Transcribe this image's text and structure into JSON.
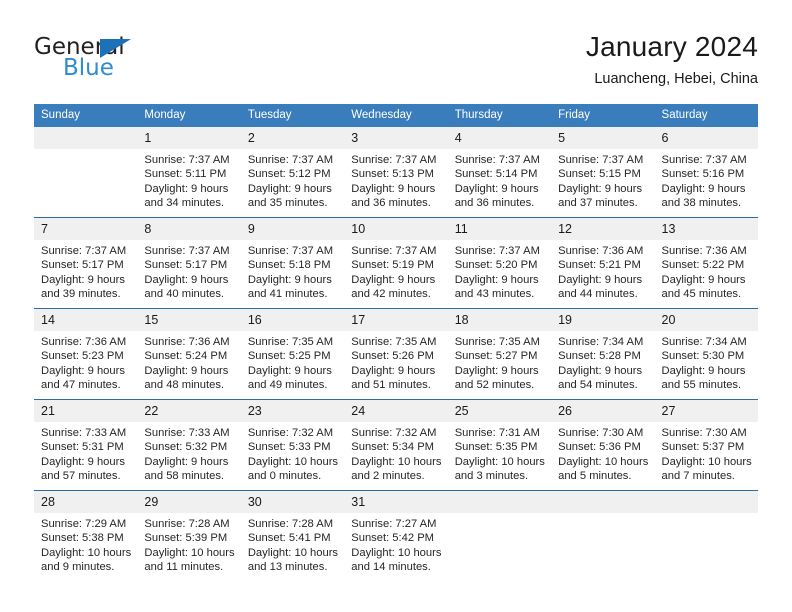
{
  "brand": {
    "name_part1": "General",
    "name_part2": "Blue",
    "triangle_icon": "triangle-icon",
    "accent_dark": "#1d71b8",
    "accent_light": "#2e8bd4"
  },
  "header": {
    "title": "January 2024",
    "subtitle": "Luancheng, Hebei, China"
  },
  "theme": {
    "header_blue": "#3a7dbd",
    "row_divider_blue": "#2e6da4",
    "daynum_band": "#f0f0f0"
  },
  "weekdays": [
    "Sunday",
    "Monday",
    "Tuesday",
    "Wednesday",
    "Thursday",
    "Friday",
    "Saturday"
  ],
  "labels": {
    "sunrise_prefix": "Sunrise:",
    "sunset_prefix": "Sunset:",
    "daylight_prefix": "Daylight:"
  },
  "weeks": [
    [
      {
        "day": "",
        "sunrise": "",
        "sunset": "",
        "daylight_line1": "",
        "daylight_line2": ""
      },
      {
        "day": "1",
        "sunrise": "Sunrise: 7:37 AM",
        "sunset": "Sunset: 5:11 PM",
        "daylight_line1": "Daylight: 9 hours",
        "daylight_line2": "and 34 minutes."
      },
      {
        "day": "2",
        "sunrise": "Sunrise: 7:37 AM",
        "sunset": "Sunset: 5:12 PM",
        "daylight_line1": "Daylight: 9 hours",
        "daylight_line2": "and 35 minutes."
      },
      {
        "day": "3",
        "sunrise": "Sunrise: 7:37 AM",
        "sunset": "Sunset: 5:13 PM",
        "daylight_line1": "Daylight: 9 hours",
        "daylight_line2": "and 36 minutes."
      },
      {
        "day": "4",
        "sunrise": "Sunrise: 7:37 AM",
        "sunset": "Sunset: 5:14 PM",
        "daylight_line1": "Daylight: 9 hours",
        "daylight_line2": "and 36 minutes."
      },
      {
        "day": "5",
        "sunrise": "Sunrise: 7:37 AM",
        "sunset": "Sunset: 5:15 PM",
        "daylight_line1": "Daylight: 9 hours",
        "daylight_line2": "and 37 minutes."
      },
      {
        "day": "6",
        "sunrise": "Sunrise: 7:37 AM",
        "sunset": "Sunset: 5:16 PM",
        "daylight_line1": "Daylight: 9 hours",
        "daylight_line2": "and 38 minutes."
      }
    ],
    [
      {
        "day": "7",
        "sunrise": "Sunrise: 7:37 AM",
        "sunset": "Sunset: 5:17 PM",
        "daylight_line1": "Daylight: 9 hours",
        "daylight_line2": "and 39 minutes."
      },
      {
        "day": "8",
        "sunrise": "Sunrise: 7:37 AM",
        "sunset": "Sunset: 5:17 PM",
        "daylight_line1": "Daylight: 9 hours",
        "daylight_line2": "and 40 minutes."
      },
      {
        "day": "9",
        "sunrise": "Sunrise: 7:37 AM",
        "sunset": "Sunset: 5:18 PM",
        "daylight_line1": "Daylight: 9 hours",
        "daylight_line2": "and 41 minutes."
      },
      {
        "day": "10",
        "sunrise": "Sunrise: 7:37 AM",
        "sunset": "Sunset: 5:19 PM",
        "daylight_line1": "Daylight: 9 hours",
        "daylight_line2": "and 42 minutes."
      },
      {
        "day": "11",
        "sunrise": "Sunrise: 7:37 AM",
        "sunset": "Sunset: 5:20 PM",
        "daylight_line1": "Daylight: 9 hours",
        "daylight_line2": "and 43 minutes."
      },
      {
        "day": "12",
        "sunrise": "Sunrise: 7:36 AM",
        "sunset": "Sunset: 5:21 PM",
        "daylight_line1": "Daylight: 9 hours",
        "daylight_line2": "and 44 minutes."
      },
      {
        "day": "13",
        "sunrise": "Sunrise: 7:36 AM",
        "sunset": "Sunset: 5:22 PM",
        "daylight_line1": "Daylight: 9 hours",
        "daylight_line2": "and 45 minutes."
      }
    ],
    [
      {
        "day": "14",
        "sunrise": "Sunrise: 7:36 AM",
        "sunset": "Sunset: 5:23 PM",
        "daylight_line1": "Daylight: 9 hours",
        "daylight_line2": "and 47 minutes."
      },
      {
        "day": "15",
        "sunrise": "Sunrise: 7:36 AM",
        "sunset": "Sunset: 5:24 PM",
        "daylight_line1": "Daylight: 9 hours",
        "daylight_line2": "and 48 minutes."
      },
      {
        "day": "16",
        "sunrise": "Sunrise: 7:35 AM",
        "sunset": "Sunset: 5:25 PM",
        "daylight_line1": "Daylight: 9 hours",
        "daylight_line2": "and 49 minutes."
      },
      {
        "day": "17",
        "sunrise": "Sunrise: 7:35 AM",
        "sunset": "Sunset: 5:26 PM",
        "daylight_line1": "Daylight: 9 hours",
        "daylight_line2": "and 51 minutes."
      },
      {
        "day": "18",
        "sunrise": "Sunrise: 7:35 AM",
        "sunset": "Sunset: 5:27 PM",
        "daylight_line1": "Daylight: 9 hours",
        "daylight_line2": "and 52 minutes."
      },
      {
        "day": "19",
        "sunrise": "Sunrise: 7:34 AM",
        "sunset": "Sunset: 5:28 PM",
        "daylight_line1": "Daylight: 9 hours",
        "daylight_line2": "and 54 minutes."
      },
      {
        "day": "20",
        "sunrise": "Sunrise: 7:34 AM",
        "sunset": "Sunset: 5:30 PM",
        "daylight_line1": "Daylight: 9 hours",
        "daylight_line2": "and 55 minutes."
      }
    ],
    [
      {
        "day": "21",
        "sunrise": "Sunrise: 7:33 AM",
        "sunset": "Sunset: 5:31 PM",
        "daylight_line1": "Daylight: 9 hours",
        "daylight_line2": "and 57 minutes."
      },
      {
        "day": "22",
        "sunrise": "Sunrise: 7:33 AM",
        "sunset": "Sunset: 5:32 PM",
        "daylight_line1": "Daylight: 9 hours",
        "daylight_line2": "and 58 minutes."
      },
      {
        "day": "23",
        "sunrise": "Sunrise: 7:32 AM",
        "sunset": "Sunset: 5:33 PM",
        "daylight_line1": "Daylight: 10 hours",
        "daylight_line2": "and 0 minutes."
      },
      {
        "day": "24",
        "sunrise": "Sunrise: 7:32 AM",
        "sunset": "Sunset: 5:34 PM",
        "daylight_line1": "Daylight: 10 hours",
        "daylight_line2": "and 2 minutes."
      },
      {
        "day": "25",
        "sunrise": "Sunrise: 7:31 AM",
        "sunset": "Sunset: 5:35 PM",
        "daylight_line1": "Daylight: 10 hours",
        "daylight_line2": "and 3 minutes."
      },
      {
        "day": "26",
        "sunrise": "Sunrise: 7:30 AM",
        "sunset": "Sunset: 5:36 PM",
        "daylight_line1": "Daylight: 10 hours",
        "daylight_line2": "and 5 minutes."
      },
      {
        "day": "27",
        "sunrise": "Sunrise: 7:30 AM",
        "sunset": "Sunset: 5:37 PM",
        "daylight_line1": "Daylight: 10 hours",
        "daylight_line2": "and 7 minutes."
      }
    ],
    [
      {
        "day": "28",
        "sunrise": "Sunrise: 7:29 AM",
        "sunset": "Sunset: 5:38 PM",
        "daylight_line1": "Daylight: 10 hours",
        "daylight_line2": "and 9 minutes."
      },
      {
        "day": "29",
        "sunrise": "Sunrise: 7:28 AM",
        "sunset": "Sunset: 5:39 PM",
        "daylight_line1": "Daylight: 10 hours",
        "daylight_line2": "and 11 minutes."
      },
      {
        "day": "30",
        "sunrise": "Sunrise: 7:28 AM",
        "sunset": "Sunset: 5:41 PM",
        "daylight_line1": "Daylight: 10 hours",
        "daylight_line2": "and 13 minutes."
      },
      {
        "day": "31",
        "sunrise": "Sunrise: 7:27 AM",
        "sunset": "Sunset: 5:42 PM",
        "daylight_line1": "Daylight: 10 hours",
        "daylight_line2": "and 14 minutes."
      },
      {
        "day": "",
        "sunrise": "",
        "sunset": "",
        "daylight_line1": "",
        "daylight_line2": ""
      },
      {
        "day": "",
        "sunrise": "",
        "sunset": "",
        "daylight_line1": "",
        "daylight_line2": ""
      },
      {
        "day": "",
        "sunrise": "",
        "sunset": "",
        "daylight_line1": "",
        "daylight_line2": ""
      }
    ]
  ]
}
